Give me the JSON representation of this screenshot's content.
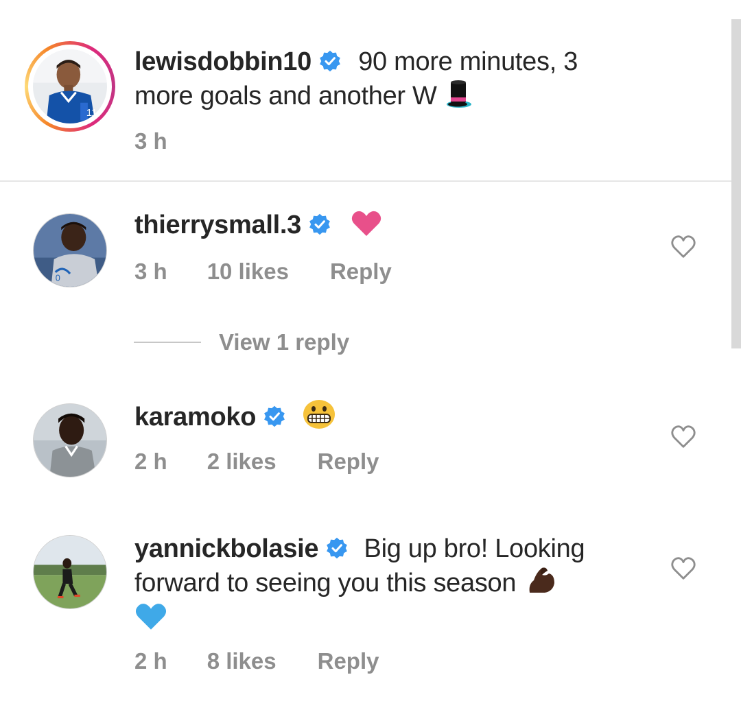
{
  "caption": {
    "username": "lewisdobbin10",
    "text": "90 more minutes, 3",
    "text_line2": "more goals and another W",
    "emoji": "top-hat-icon",
    "time": "3 h"
  },
  "comments": [
    {
      "username": "thierrysmall.3",
      "text": "",
      "emoji": "pink-heart-icon",
      "time": "3 h",
      "likes": "10 likes",
      "reply_label": "Reply",
      "view_replies": "View 1 reply"
    },
    {
      "username": "karamoko",
      "text": "",
      "emoji": "grimacing-face-icon",
      "time": "2 h",
      "likes": "2 likes",
      "reply_label": "Reply"
    },
    {
      "username": "yannickbolasie",
      "text": "Big up bro! Looking",
      "text_line2": "forward to seeing you this season",
      "emoji": "flexed-biceps-icon",
      "emoji_line3": "blue-heart-icon",
      "time": "2 h",
      "likes": "8 likes",
      "reply_label": "Reply"
    }
  ],
  "colors": {
    "verified": "#3897f0",
    "meta_text": "#8e8e8e",
    "primary_text": "#262626",
    "pink_heart": "#e8508a",
    "blue_heart": "#3fa9e8"
  }
}
